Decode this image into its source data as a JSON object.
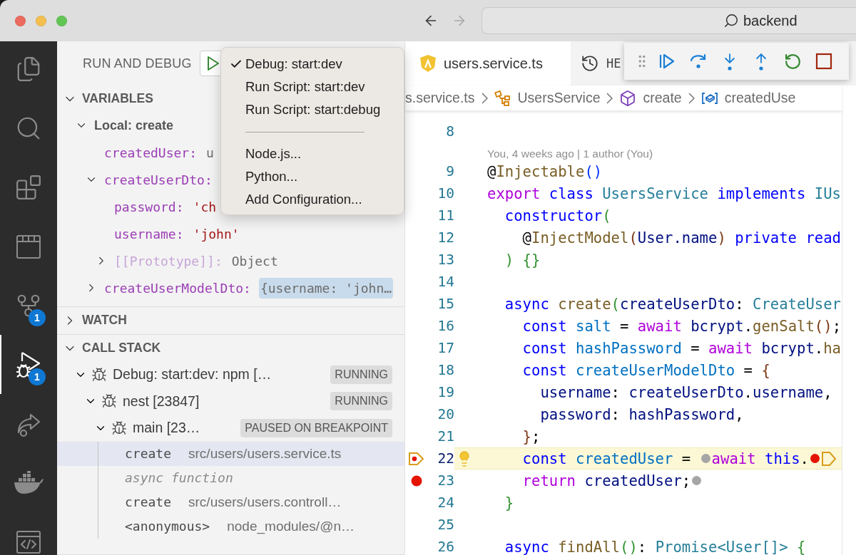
{
  "window": {
    "search": "backend"
  },
  "activity_bar": {
    "items": [
      {
        "kind": "explorer",
        "selected": false
      },
      {
        "kind": "search",
        "selected": false
      },
      {
        "kind": "extensions",
        "selected": false
      },
      {
        "kind": "board",
        "selected": false
      },
      {
        "kind": "source_control",
        "selected": false,
        "badge": "1"
      },
      {
        "kind": "debug",
        "selected": true,
        "badge": "1"
      },
      {
        "kind": "share",
        "selected": false
      },
      {
        "kind": "docker",
        "selected": false
      },
      {
        "kind": "browser",
        "selected": false
      }
    ]
  },
  "sidebar": {
    "title": "RUN AND DEBUG",
    "variables": {
      "title": "VARIABLES",
      "expanded": true,
      "items": [
        {
          "name": "Local: create",
          "kind": "scope",
          "expanded": true,
          "children": [
            {
              "name": "createdUser:",
              "kind": "plain",
              "value": "u",
              "changed": false
            },
            {
              "name": "createUserDto:",
              "kind": "plain",
              "expanded": true,
              "children": [
                {
                  "name": "password:",
                  "kind": "string",
                  "value": "'ch",
                  "changed": false
                },
                {
                  "name": "username:",
                  "kind": "string",
                  "value": "'john'",
                  "changed": false
                },
                {
                  "name": "[[Prototype]]:",
                  "kind": "internal",
                  "value": "Object",
                  "changed": false,
                  "expanded": false
                }
              ]
            },
            {
              "name": "createUserModelDto:",
              "kind": "plain",
              "value": "{username: 'john…",
              "changed": true,
              "expanded": false
            }
          ]
        }
      ]
    },
    "watch": {
      "title": "WATCH",
      "expanded": false
    },
    "call_stack": {
      "title": "CALL STACK",
      "expanded": true,
      "items": [
        {
          "kind": "session",
          "label": "Debug: start:dev: npm […",
          "status": "RUNNING",
          "expanded": true,
          "children": [
            {
              "kind": "session",
              "label": "nest [23847]",
              "status": "RUNNING",
              "expanded": true,
              "children": [
                {
                  "kind": "session",
                  "label": "main [23…",
                  "status": "PAUSED ON BREAKPOINT",
                  "expanded": true,
                  "children": [
                    {
                      "kind": "frame",
                      "name": "create",
                      "source": "src/users/users.service.ts",
                      "selected": true
                    },
                    {
                      "kind": "label",
                      "name": "async function",
                      "selected": false
                    },
                    {
                      "kind": "frame",
                      "name": "create",
                      "source": "src/users/users.controll…",
                      "selected": false
                    },
                    {
                      "kind": "frame",
                      "name": "<anonymous>",
                      "source": "node_modules/@n…",
                      "selected": false
                    }
                  ]
                }
              ]
            }
          ]
        }
      ]
    }
  },
  "launch_menu": {
    "items": [
      {
        "kind": "item",
        "label": "Debug: start:dev",
        "checked": true
      },
      {
        "kind": "item",
        "label": "Run Script: start:dev",
        "checked": false
      },
      {
        "kind": "item",
        "label": "Run Script: start:debug",
        "checked": false
      },
      {
        "kind": "separator"
      },
      {
        "kind": "item",
        "label": "Node.js...",
        "checked": false
      },
      {
        "kind": "item",
        "label": "Python...",
        "checked": false
      },
      {
        "kind": "item",
        "label": "Add Configuration...",
        "checked": false
      }
    ]
  },
  "editor": {
    "tabs": [
      {
        "kind": "file",
        "label": "users.service.ts",
        "selected": true
      },
      {
        "kind": "history",
        "label": "HE",
        "selected": false
      }
    ],
    "debug_toolbar": {
      "actions": [
        {
          "kind": "continue"
        },
        {
          "kind": "step_over"
        },
        {
          "kind": "step_into"
        },
        {
          "kind": "step_out"
        },
        {
          "kind": "restart"
        },
        {
          "kind": "stop"
        }
      ]
    },
    "breadcrumbs": [
      {
        "kind": "file",
        "label": "s.service.ts"
      },
      {
        "kind": "class",
        "label": "UsersService"
      },
      {
        "kind": "method",
        "label": "create"
      },
      {
        "kind": "variable",
        "label": "createdUse"
      }
    ],
    "lines": [
      {
        "number": "8",
        "current": false,
        "lightbulb": false,
        "breakpoint": false
      },
      {
        "number": "9",
        "current": false,
        "lightbulb": false,
        "breakpoint": false,
        "lens": "You, 4 weeks ago | 1 author (You)",
        "tokens": [
          {
            "kind": "plain",
            "text": "@"
          },
          {
            "kind": "func",
            "text": "Injectable"
          },
          {
            "kind": "bracket_a",
            "text": "()"
          }
        ]
      },
      {
        "number": "10",
        "current": false,
        "lightbulb": false,
        "breakpoint": false,
        "tokens": [
          {
            "kind": "control",
            "text": "export "
          },
          {
            "kind": "keyword",
            "text": "class "
          },
          {
            "kind": "type",
            "text": "UsersService "
          },
          {
            "kind": "keyword",
            "text": "implements "
          },
          {
            "kind": "type",
            "text": "IUs"
          }
        ]
      },
      {
        "number": "11",
        "current": false,
        "lightbulb": false,
        "breakpoint": false,
        "tokens": [
          {
            "kind": "keyword",
            "text": "  constructor"
          },
          {
            "kind": "bracket_b",
            "text": "("
          }
        ]
      },
      {
        "number": "12",
        "current": false,
        "lightbulb": false,
        "breakpoint": false,
        "tokens": [
          {
            "kind": "plain",
            "text": "    @"
          },
          {
            "kind": "func",
            "text": "InjectModel"
          },
          {
            "kind": "bracket_c",
            "text": "("
          },
          {
            "kind": "var",
            "text": "User.name"
          },
          {
            "kind": "bracket_c",
            "text": ") "
          },
          {
            "kind": "keyword",
            "text": "private "
          },
          {
            "kind": "keyword",
            "text": "read"
          }
        ]
      },
      {
        "number": "13",
        "current": false,
        "lightbulb": false,
        "breakpoint": false,
        "tokens": [
          {
            "kind": "bracket_b",
            "text": "  ) {}"
          }
        ]
      },
      {
        "number": "14",
        "current": false,
        "lightbulb": false,
        "breakpoint": false
      },
      {
        "number": "15",
        "current": false,
        "lightbulb": false,
        "breakpoint": false,
        "tokens": [
          {
            "kind": "keyword",
            "text": "  async "
          },
          {
            "kind": "func",
            "text": "create"
          },
          {
            "kind": "bracket_b",
            "text": "("
          },
          {
            "kind": "var",
            "text": "createUserDto"
          },
          {
            "kind": "plain",
            "text": ": "
          },
          {
            "kind": "type",
            "text": "CreateUser"
          }
        ]
      },
      {
        "number": "16",
        "current": false,
        "lightbulb": false,
        "breakpoint": false,
        "tokens": [
          {
            "kind": "keyword",
            "text": "    const "
          },
          {
            "kind": "const",
            "text": "salt"
          },
          {
            "kind": "plain",
            "text": " = "
          },
          {
            "kind": "control",
            "text": "await "
          },
          {
            "kind": "var",
            "text": "bcrypt"
          },
          {
            "kind": "plain",
            "text": "."
          },
          {
            "kind": "func",
            "text": "genSalt"
          },
          {
            "kind": "bracket_c",
            "text": "()"
          },
          {
            "kind": "plain",
            "text": ";"
          }
        ]
      },
      {
        "number": "17",
        "current": false,
        "lightbulb": false,
        "breakpoint": false,
        "tokens": [
          {
            "kind": "keyword",
            "text": "    const "
          },
          {
            "kind": "const",
            "text": "hashPassword"
          },
          {
            "kind": "plain",
            "text": " = "
          },
          {
            "kind": "control",
            "text": "await "
          },
          {
            "kind": "var",
            "text": "bcrypt"
          },
          {
            "kind": "plain",
            "text": "."
          },
          {
            "kind": "func",
            "text": "ha"
          }
        ]
      },
      {
        "number": "18",
        "current": false,
        "lightbulb": false,
        "breakpoint": false,
        "tokens": [
          {
            "kind": "keyword",
            "text": "    const "
          },
          {
            "kind": "const",
            "text": "createUserModelDto"
          },
          {
            "kind": "plain",
            "text": " = "
          },
          {
            "kind": "bracket_c",
            "text": "{"
          }
        ]
      },
      {
        "number": "19",
        "current": false,
        "lightbulb": false,
        "breakpoint": false,
        "tokens": [
          {
            "kind": "var",
            "text": "      username"
          },
          {
            "kind": "plain",
            "text": ": "
          },
          {
            "kind": "var",
            "text": "createUserDto"
          },
          {
            "kind": "plain",
            "text": "."
          },
          {
            "kind": "var",
            "text": "username"
          },
          {
            "kind": "plain",
            "text": ","
          }
        ]
      },
      {
        "number": "20",
        "current": false,
        "lightbulb": false,
        "breakpoint": false,
        "tokens": [
          {
            "kind": "var",
            "text": "      password"
          },
          {
            "kind": "plain",
            "text": ": "
          },
          {
            "kind": "var",
            "text": "hashPassword"
          },
          {
            "kind": "plain",
            "text": ","
          }
        ]
      },
      {
        "number": "21",
        "current": false,
        "lightbulb": false,
        "breakpoint": false,
        "tokens": [
          {
            "kind": "bracket_c",
            "text": "    }"
          },
          {
            "kind": "plain",
            "text": ";"
          }
        ]
      },
      {
        "number": "22",
        "current": true,
        "lightbulb": true,
        "breakpoint": true,
        "tokens": [
          {
            "kind": "keyword",
            "text": "    const "
          },
          {
            "kind": "const",
            "text": "createdUser"
          },
          {
            "kind": "plain",
            "text": " = "
          },
          {
            "kind": "marker",
            "color": "#a6a6a6"
          },
          {
            "kind": "control",
            "text": "await "
          },
          {
            "kind": "keyword",
            "text": "this"
          },
          {
            "kind": "plain",
            "text": "."
          },
          {
            "kind": "marker",
            "color": "#e51400"
          },
          {
            "kind": "paused_marker"
          }
        ]
      },
      {
        "number": "23",
        "current": false,
        "lightbulb": false,
        "breakpoint": true,
        "tokens": [
          {
            "kind": "control",
            "text": "    return "
          },
          {
            "kind": "var",
            "text": "createdUser"
          },
          {
            "kind": "plain",
            "text": ";"
          },
          {
            "kind": "marker",
            "color": "#a6a6a6"
          }
        ]
      },
      {
        "number": "24",
        "current": false,
        "lightbulb": false,
        "breakpoint": false,
        "tokens": [
          {
            "kind": "bracket_b",
            "text": "  }"
          }
        ]
      },
      {
        "number": "25",
        "current": false,
        "lightbulb": false,
        "breakpoint": false
      },
      {
        "number": "26",
        "current": false,
        "lightbulb": false,
        "breakpoint": false,
        "tokens": [
          {
            "kind": "keyword",
            "text": "  async "
          },
          {
            "kind": "func",
            "text": "findAll"
          },
          {
            "kind": "bracket_b",
            "text": "()"
          },
          {
            "kind": "plain",
            "text": ": "
          },
          {
            "kind": "type",
            "text": "Promise<User[]> "
          },
          {
            "kind": "bracket_b",
            "text": "{"
          }
        ]
      }
    ]
  }
}
